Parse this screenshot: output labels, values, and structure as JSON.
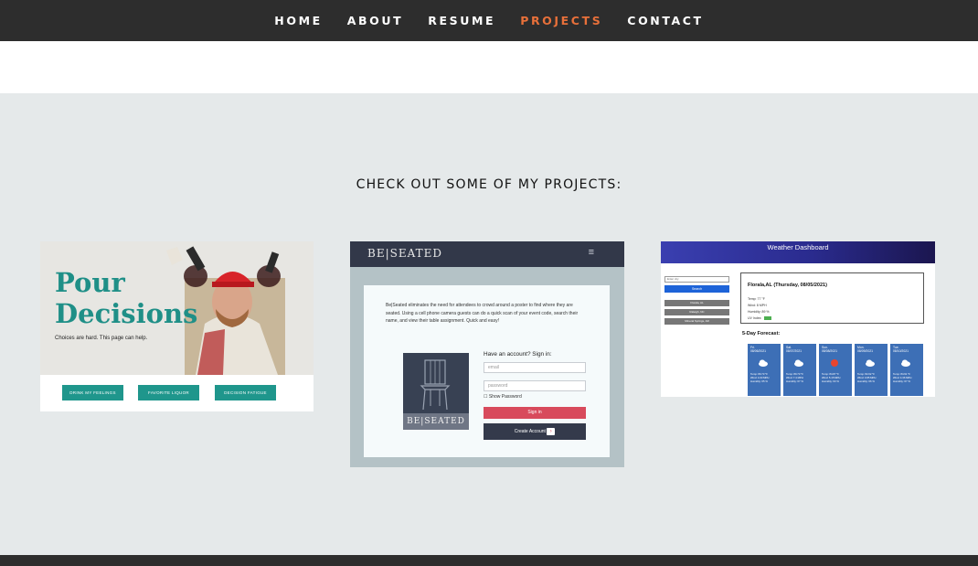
{
  "nav": {
    "items": [
      {
        "label": "HOME",
        "active": false
      },
      {
        "label": "ABOUT",
        "active": false
      },
      {
        "label": "RESUME",
        "active": false
      },
      {
        "label": "PROJECTS",
        "active": true
      },
      {
        "label": "CONTACT",
        "active": false
      }
    ],
    "active_color": "#e8703a"
  },
  "section": {
    "heading": "CHECK OUT SOME OF MY PROJECTS:"
  },
  "projects": {
    "pour_decisions": {
      "title_line1": "Pour",
      "title_line2": "Decisions",
      "tagline": "Choices are hard. This page can help.",
      "buttons": [
        "DRINK MY FEELINGS",
        "FAVORITE LIQUOR",
        "DECISION FATIGUE"
      ]
    },
    "beseated": {
      "brand": "BE|SEATED",
      "menu_icon": "hamburger-icon",
      "description": "Be|Seated eliminates the need for attendees to crowd around a poster to find where they are seated. Using a cell phone camera guests can do a quick scan of your event code, search their name, and view their table assignment. Quick and easy!",
      "chair_label": "BE|SEATED",
      "signin_heading": "Have an account? Sign in:",
      "email_placeholder": "email",
      "password_placeholder": "password",
      "show_password": "Show Password",
      "signin_button": "Sign in",
      "create_button": "Create Account"
    },
    "weather": {
      "header": "Weather Dashboard",
      "city_placeholder": "Enter city",
      "search_button": "Search",
      "history": [
        "Florala, AL",
        "Raleigh, NC",
        "Mineral Springs, AR"
      ],
      "current_title": "Florala,AL (Thursday, 08/05/2021)",
      "current_lines": [
        "Temp: 77 °F",
        "Wind: 8 MPH",
        "Humidity: 89 %",
        "UV Index:"
      ],
      "forecast_title": "5-Day Forecast:",
      "days": [
        {
          "day": "Fri.",
          "date": "08/06/2021",
          "temp": "Temp: 80.73 °F",
          "wind": "Wind: 4.03 MPH",
          "hum": "Humidity: 65 %"
        },
        {
          "day": "Sat.",
          "date": "08/07/2021",
          "temp": "Temp: 80.73 °F",
          "wind": "Wind: 7.4 MPH",
          "hum": "Humidity: 67 %"
        },
        {
          "day": "Sun.",
          "date": "08/08/2021",
          "temp": "Temp: 84.87 °F",
          "wind": "Wind: 5.15 MPH",
          "hum": "Humidity: 63 %"
        },
        {
          "day": "Mon.",
          "date": "08/09/2021",
          "temp": "Temp: 82.02 °F",
          "wind": "Wind: 3.85 MPH",
          "hum": "Humidity: 66 %"
        },
        {
          "day": "Tue.",
          "date": "08/10/2021",
          "temp": "Temp: 84.91 °F",
          "wind": "Wind: 4.36 MPH",
          "hum": "Humidity: 67 %"
        }
      ]
    }
  }
}
